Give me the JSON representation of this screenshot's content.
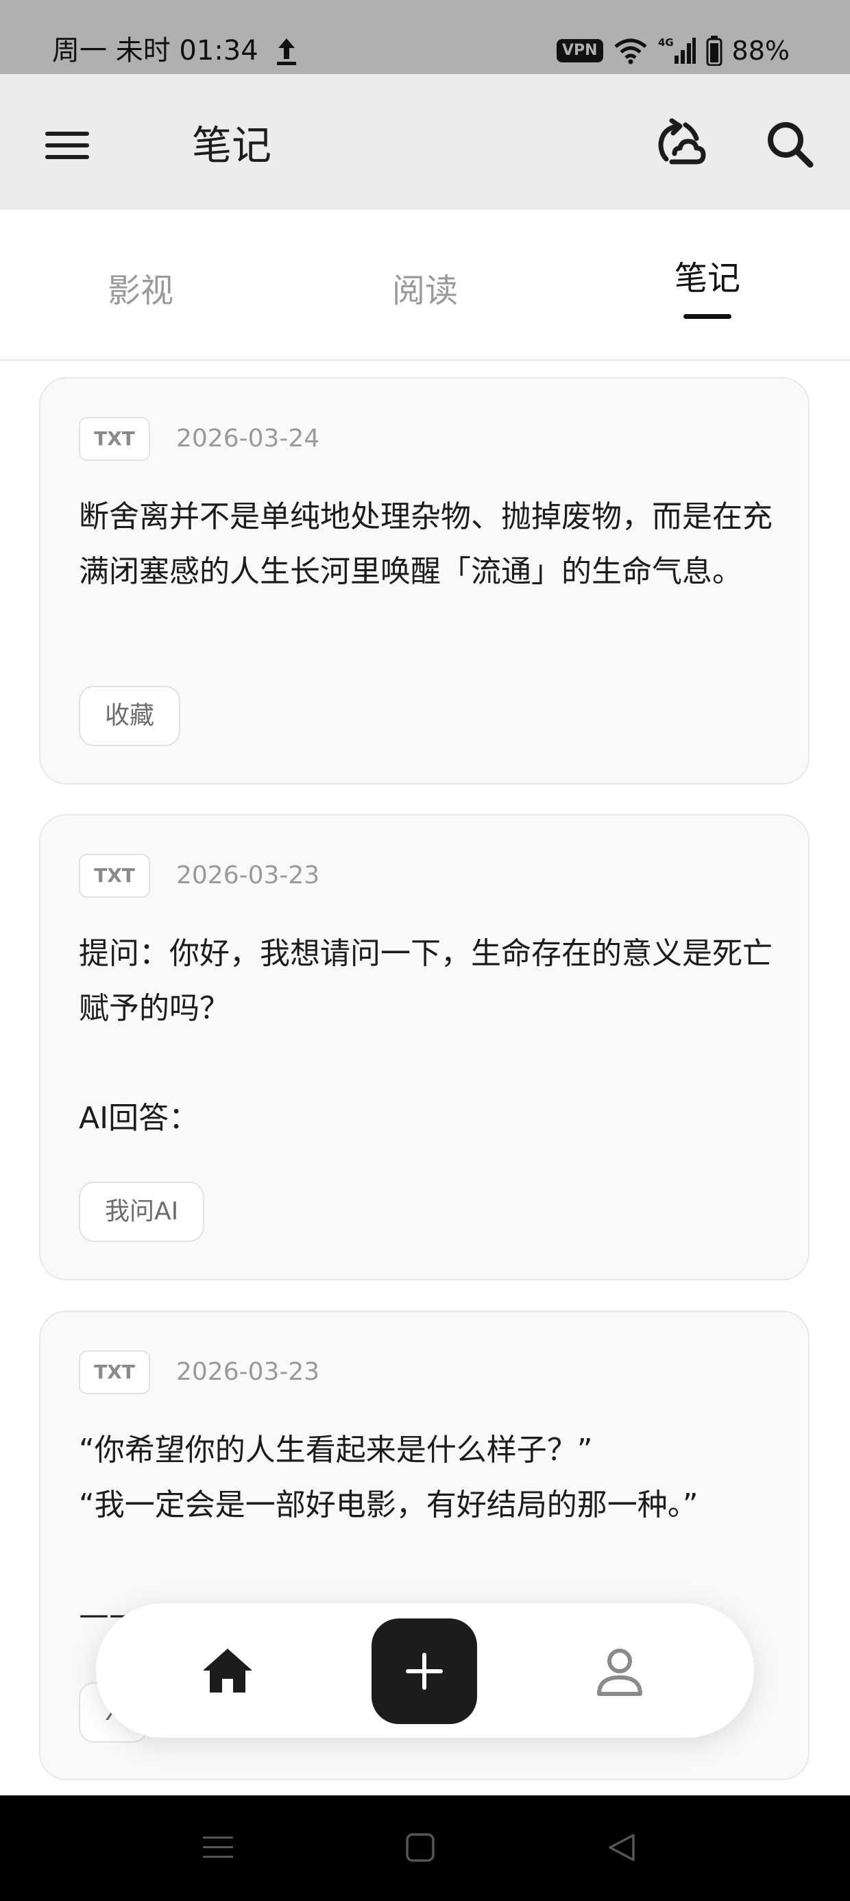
{
  "status_bar": {
    "time": "周一 未时 01:34",
    "vpn": "VPN",
    "network": "4G",
    "battery": "88%"
  },
  "header": {
    "title": "笔记"
  },
  "tabs": [
    {
      "label": "影视",
      "active": false
    },
    {
      "label": "阅读",
      "active": false
    },
    {
      "label": "笔记",
      "active": true
    }
  ],
  "notes": [
    {
      "type": "TXT",
      "date": "2026-03-24",
      "text": "断舍离并不是单纯地处理杂物、抛掉废物，而是在充满闭塞感的人生长河里唤醒「流通」的生命气息。",
      "tag": "收藏"
    },
    {
      "type": "TXT",
      "date": "2026-03-23",
      "text": "提问：你好，我想请问一下，生命存在的意义是死亡赋予的吗？\n\nAI回答：",
      "tag": "我问AI"
    },
    {
      "type": "TXT",
      "date": "2026-03-23",
      "text": "“你希望你的人生看起来是什么样子？”\n“我一定会是一部好电影，有好结局的那一种。”\n\n——",
      "tag": "X"
    }
  ],
  "icons": {
    "menu": "hamburger-menu-icon",
    "sync": "sync-icon",
    "search": "search-icon",
    "home": "home-icon",
    "add": "plus-icon",
    "profile": "person-icon"
  },
  "colors": {
    "accent": "#1c1c1c",
    "status_bar_bg": "#b0b0b0",
    "appbar_bg": "#ececec",
    "card_bg": "#f9f9f9",
    "muted_text": "#9a9a9a"
  }
}
